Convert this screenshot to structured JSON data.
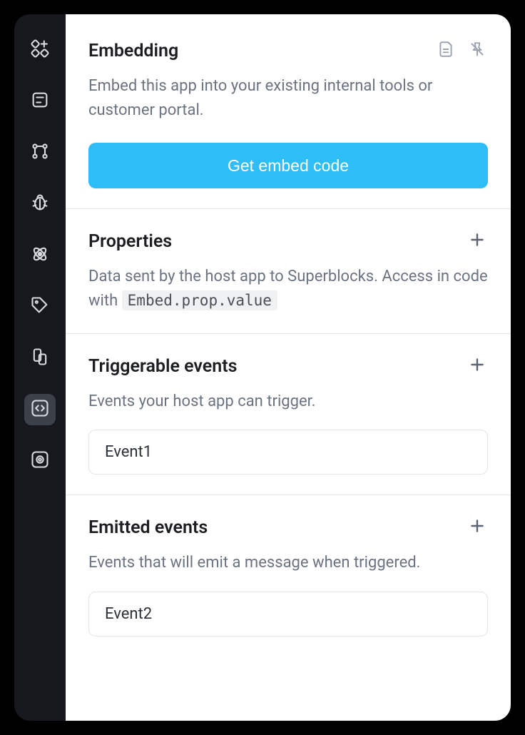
{
  "sidebar": {
    "items": [
      {
        "name": "components-icon"
      },
      {
        "name": "layout-icon"
      },
      {
        "name": "workflow-icon"
      },
      {
        "name": "debug-icon"
      },
      {
        "name": "atom-icon"
      },
      {
        "name": "tag-icon"
      },
      {
        "name": "device-icon"
      },
      {
        "name": "code-icon",
        "active": true
      },
      {
        "name": "preview-icon"
      }
    ]
  },
  "embedding": {
    "title": "Embedding",
    "description": "Embed this app into your existing internal tools or customer portal.",
    "button_label": "Get embed code"
  },
  "properties": {
    "title": "Properties",
    "description_prefix": "Data sent by the host app to Superblocks. Access in code with ",
    "code": "Embed.prop.value"
  },
  "triggerable": {
    "title": "Triggerable events",
    "description": "Events your host app can trigger.",
    "items": [
      "Event1"
    ]
  },
  "emitted": {
    "title": "Emitted events",
    "description": "Events that will emit a message when triggered.",
    "items": [
      "Event2"
    ]
  }
}
